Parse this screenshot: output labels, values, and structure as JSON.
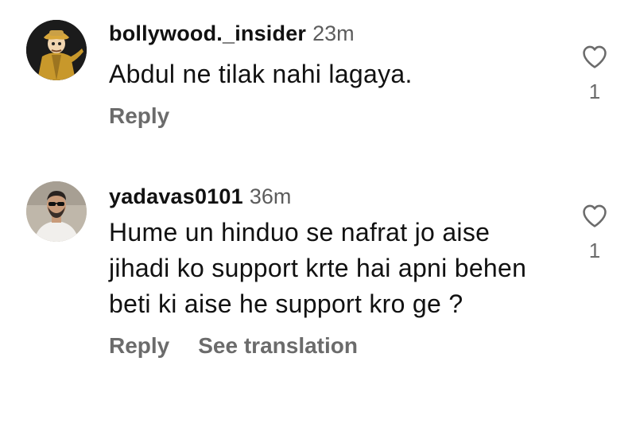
{
  "comments": [
    {
      "username": "bollywood._insider",
      "time": "23m",
      "text": "Abdul ne tilak nahi lagaya.",
      "reply_label": "Reply",
      "like_count": "1",
      "avatar_icon": "detective-cartoon-avatar"
    },
    {
      "username": "yadavas0101",
      "time": "36m",
      "text": "Hume un hinduo se nafrat jo aise jihadi ko support krte hai apni behen beti ki aise he support kro ge ?",
      "reply_label": "Reply",
      "see_translation_label": "See translation",
      "like_count": "1",
      "avatar_icon": "profile-photo-avatar"
    }
  ],
  "colors": {
    "text_primary": "#111111",
    "text_secondary": "#5c5c5c",
    "action_gray": "#6b6b6b"
  }
}
